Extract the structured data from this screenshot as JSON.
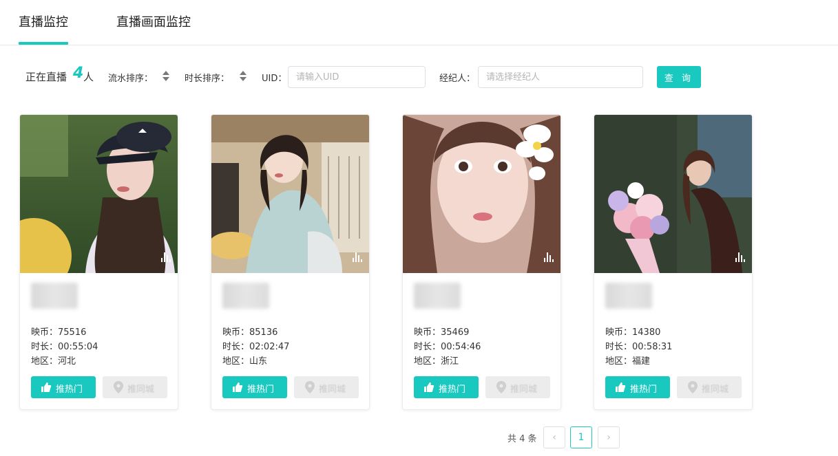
{
  "tabs": [
    {
      "label": "直播监控",
      "active": true
    },
    {
      "label": "直播画面监控",
      "active": false
    }
  ],
  "filters": {
    "live_prefix": "正在直播",
    "live_count": "4",
    "live_unit": "人",
    "sort_flow": "流水排序",
    "sort_duration": "时长排序",
    "uid_label": "UID",
    "uid_placeholder": "请输入UID",
    "agent_label": "经纪人",
    "agent_placeholder": "请选择经纪人",
    "query_button": "查 询"
  },
  "cards": [
    {
      "coins": "映币：75516",
      "duration": "时长：00:55:04",
      "region": "地区：河北",
      "hot_button": "推热门",
      "city_button": "推同城"
    },
    {
      "coins": "映币：85136",
      "duration": "时长：02:02:47",
      "region": "地区：山东",
      "hot_button": "推热门",
      "city_button": "推同城"
    },
    {
      "coins": "映币：35469",
      "duration": "时长：00:54:46",
      "region": "地区：浙江",
      "hot_button": "推热门",
      "city_button": "推同城"
    },
    {
      "coins": "映币：14380",
      "duration": "时长：00:58:31",
      "region": "地区：福建",
      "hot_button": "推热门",
      "city_button": "推同城"
    }
  ],
  "pagination": {
    "total": "共 4 条",
    "current_page": "1",
    "prev": "‹",
    "next": "›"
  },
  "colors": {
    "accent": "#19c9c0"
  }
}
